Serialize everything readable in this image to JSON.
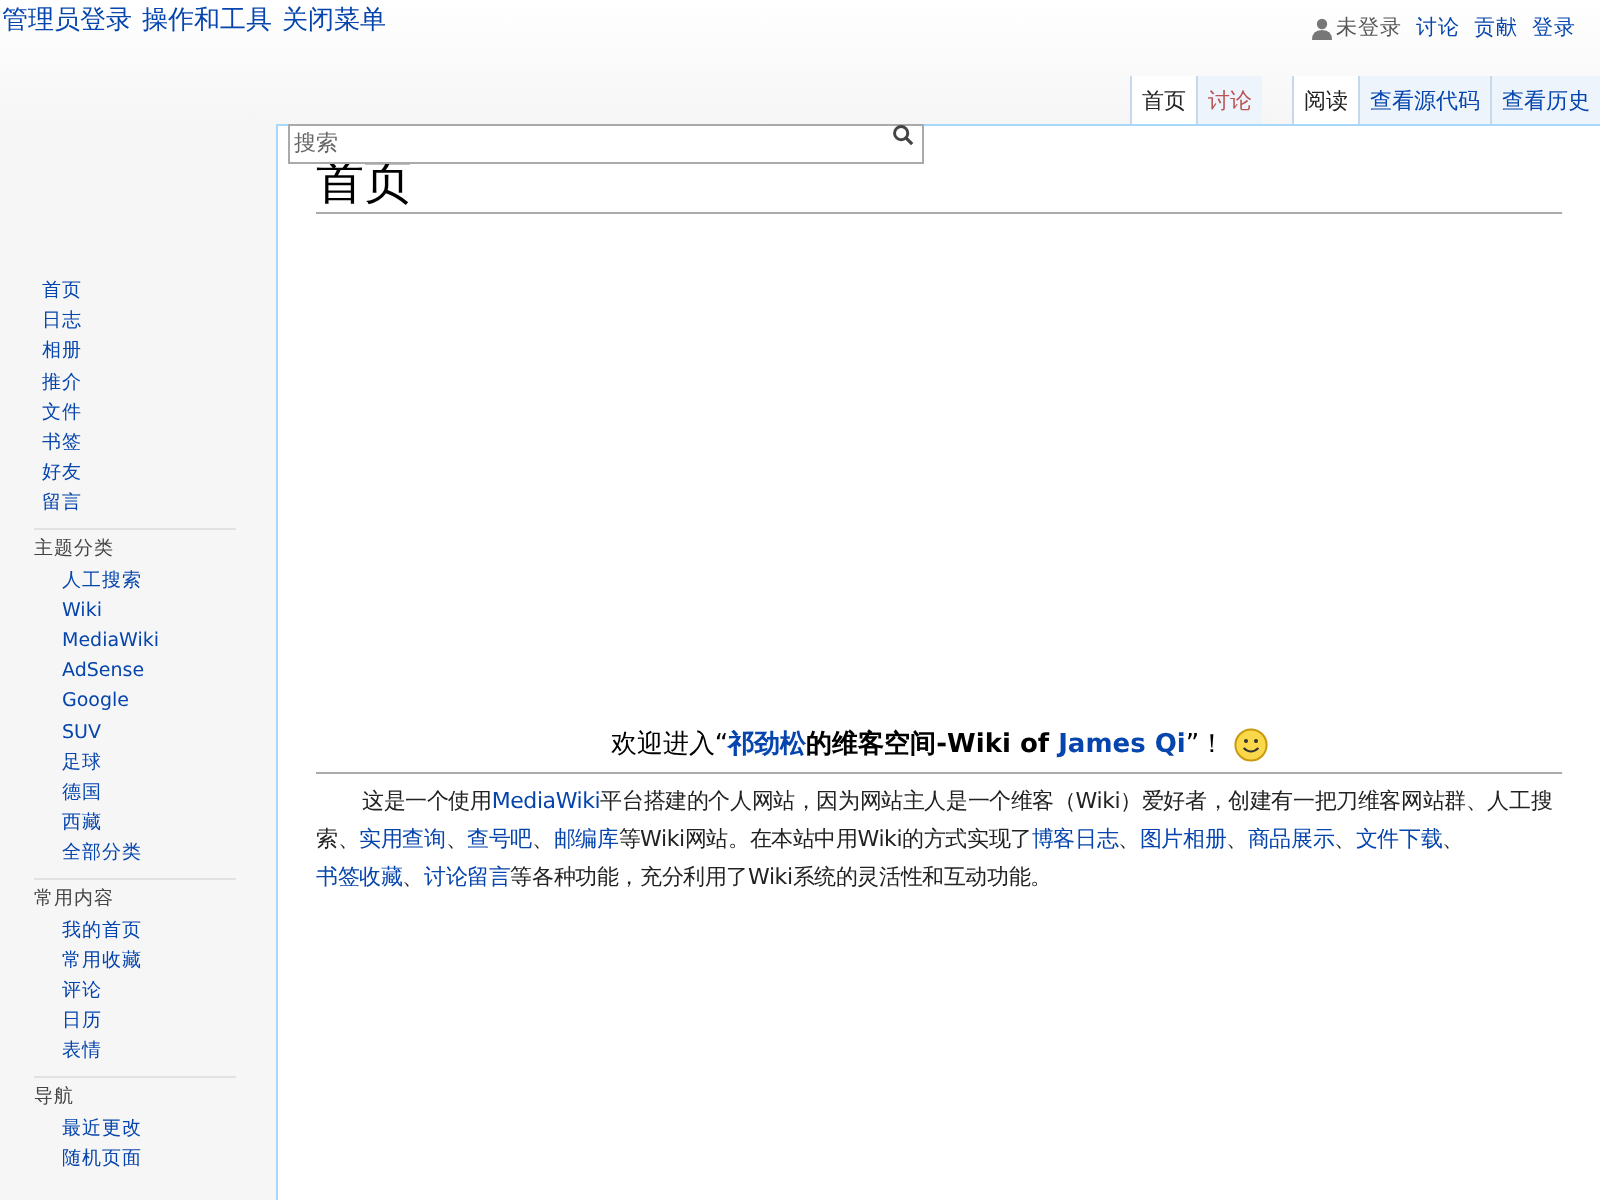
{
  "top_links": [
    "管理员登录",
    "操作和工具",
    "关闭菜单"
  ],
  "personal": {
    "user": "未登录",
    "links": [
      "讨论",
      "贡献",
      "登录"
    ]
  },
  "search": {
    "placeholder": "搜索"
  },
  "left_tabs": [
    {
      "label": "首页",
      "selected": true,
      "new": false
    },
    {
      "label": "讨论",
      "selected": false,
      "new": true
    }
  ],
  "right_tabs": [
    {
      "label": "阅读",
      "selected": true,
      "new": false
    },
    {
      "label": "查看源代码",
      "selected": false,
      "new": false
    },
    {
      "label": "查看历史",
      "selected": false,
      "new": false
    }
  ],
  "page_title": "首页",
  "sidebar": [
    {
      "items": [
        "首页",
        "日志",
        "相册",
        "推介",
        "文件",
        "书签",
        "好友",
        "留言"
      ]
    },
    {
      "heading": "主题分类",
      "items": [
        "人工搜索",
        "Wiki",
        "MediaWiki",
        "AdSense",
        "Google",
        "SUV",
        "足球",
        "德国",
        "西藏",
        "全部分类"
      ]
    },
    {
      "heading": "常用内容",
      "items": [
        "我的首页",
        "常用收藏",
        "评论",
        "日历",
        "表情"
      ]
    },
    {
      "heading": "导航",
      "items": [
        "最近更改",
        "随机页面"
      ]
    }
  ],
  "welcome": [
    {
      "kind": "text",
      "text": "欢迎进入“"
    },
    {
      "kind": "link",
      "text": "祁劲松"
    },
    {
      "kind": "bold",
      "text": "的维客空间-Wiki of "
    },
    {
      "kind": "link",
      "text": "James Qi"
    },
    {
      "kind": "text",
      "text": "”！"
    }
  ],
  "intro": [
    {
      "kind": "text",
      "text": "这是一个使用"
    },
    {
      "kind": "link",
      "text": "MediaWiki"
    },
    {
      "kind": "text",
      "text": "平台搭建的个人网站，因为网站主人是一个维客（Wiki）爱好者，创建有一把刀维客网站群、人工搜索、"
    },
    {
      "kind": "link",
      "text": "实用查询"
    },
    {
      "kind": "text",
      "text": "、"
    },
    {
      "kind": "link",
      "text": "查号吧"
    },
    {
      "kind": "text",
      "text": "、"
    },
    {
      "kind": "link",
      "text": "邮编库"
    },
    {
      "kind": "text",
      "text": "等Wiki网站。在本站中用Wiki的方式实现了"
    },
    {
      "kind": "link",
      "text": "博客日志"
    },
    {
      "kind": "text",
      "text": "、"
    },
    {
      "kind": "link",
      "text": "图片相册"
    },
    {
      "kind": "text",
      "text": "、"
    },
    {
      "kind": "link",
      "text": "商品展示"
    },
    {
      "kind": "text",
      "text": "、"
    },
    {
      "kind": "link",
      "text": "文件下载"
    },
    {
      "kind": "text",
      "text": "、"
    },
    {
      "kind": "link",
      "text": "书签收藏"
    },
    {
      "kind": "text",
      "text": "、"
    },
    {
      "kind": "link",
      "text": "讨论留言"
    },
    {
      "kind": "text",
      "text": "等各种功能，充分利用了Wiki系统的灵活性和互动功能。"
    }
  ]
}
